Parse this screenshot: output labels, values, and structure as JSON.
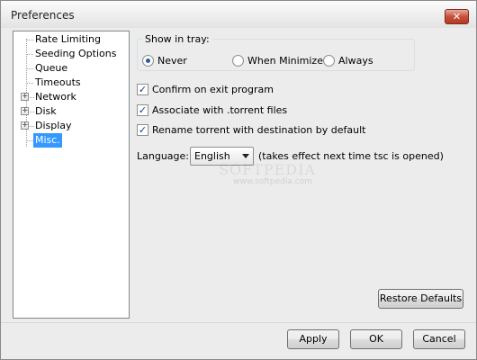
{
  "window": {
    "title": "Preferences",
    "close_symbol": "✕"
  },
  "tree": {
    "items": [
      {
        "label": "Rate Limiting",
        "expandable": false
      },
      {
        "label": "Seeding Options",
        "expandable": false
      },
      {
        "label": "Queue",
        "expandable": false
      },
      {
        "label": "Timeouts",
        "expandable": false
      },
      {
        "label": "Network",
        "expandable": true,
        "expander": "+"
      },
      {
        "label": "Disk",
        "expandable": true,
        "expander": "+"
      },
      {
        "label": "Display",
        "expandable": true,
        "expander": "+"
      },
      {
        "label": "Misc.",
        "expandable": false,
        "selected": true
      }
    ]
  },
  "tray": {
    "legend": "Show in tray:",
    "options": [
      {
        "label": "Never",
        "checked": true
      },
      {
        "label": "When Minimized",
        "checked": false
      },
      {
        "label": "Always",
        "checked": false
      }
    ]
  },
  "checkboxes": [
    {
      "label": "Confirm on exit program",
      "checked": true,
      "mark": "✓"
    },
    {
      "label": "Associate with .torrent files",
      "checked": true,
      "mark": "✓"
    },
    {
      "label": "Rename torrent with destination by default",
      "checked": true,
      "mark": "✓"
    }
  ],
  "language": {
    "label": "Language:",
    "value": "English",
    "note": "(takes effect next time tsc is opened)"
  },
  "buttons": {
    "restore": "Restore Defaults",
    "apply": "Apply",
    "ok": "OK",
    "cancel": "Cancel"
  },
  "watermark": {
    "text": "SOFTPEDIA",
    "sub": "www.softpedia.com"
  },
  "colors": {
    "selection": "#3399ff",
    "close_button": "#c8513b"
  }
}
